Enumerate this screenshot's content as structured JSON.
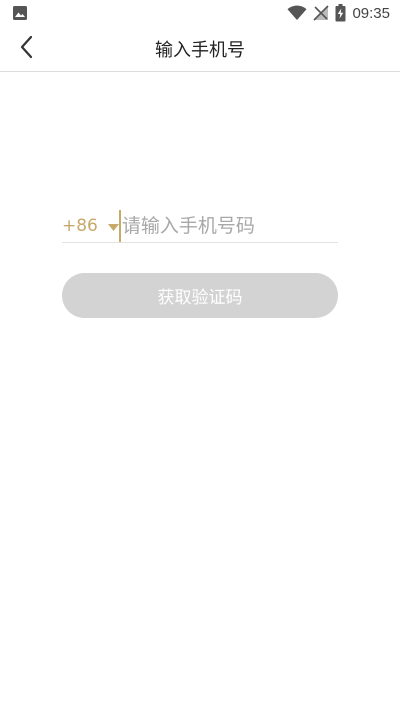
{
  "status_bar": {
    "time": "09:35",
    "icons": [
      "image-icon",
      "wifi-icon",
      "no-sim-icon",
      "battery-charging-icon"
    ]
  },
  "nav": {
    "title": "输入手机号",
    "back_icon": "chevron-left-icon"
  },
  "form": {
    "country_code": "+86",
    "phone_placeholder": "请输入手机号码",
    "phone_value": "",
    "get_code_label": "获取验证码"
  },
  "colors": {
    "accent": "#c7a96b",
    "button_disabled": "#d3d3d3",
    "placeholder": "#a8a8a8",
    "divider": "#dcdcdc"
  }
}
